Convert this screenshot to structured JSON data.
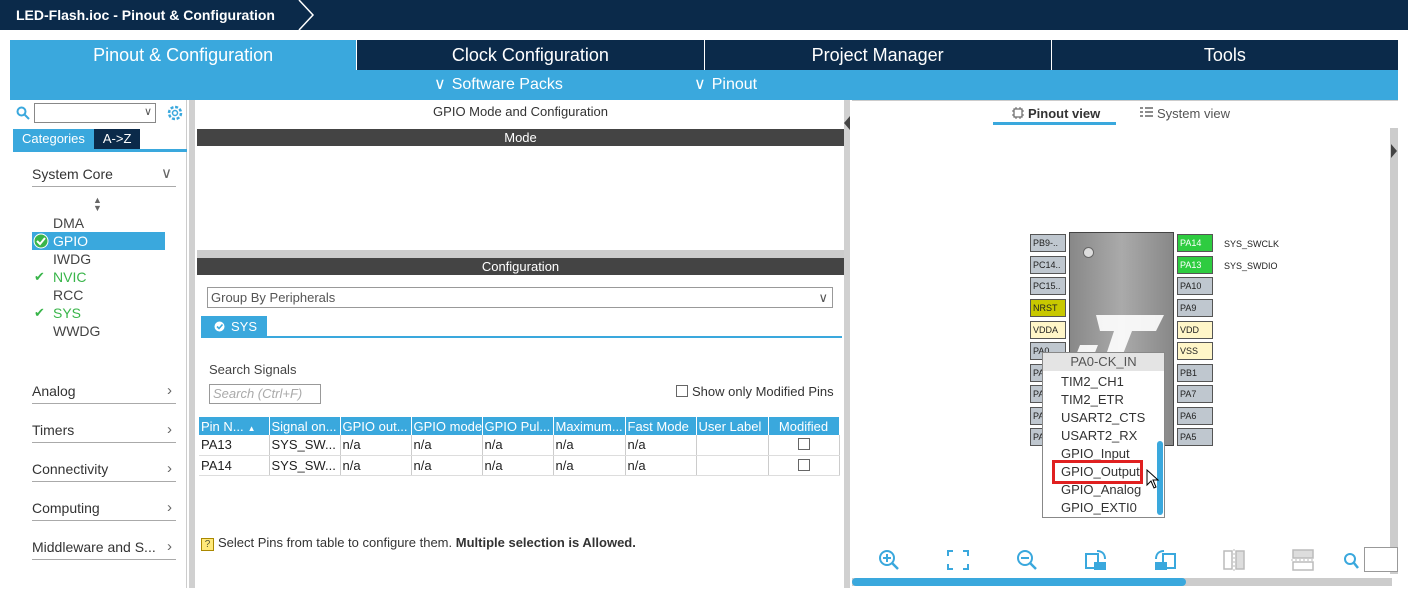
{
  "titlebar": {
    "title": "LED-Flash.ioc - Pinout & Configuration"
  },
  "main_tabs": [
    {
      "label": "Pinout & Configuration"
    },
    {
      "label": "Clock Configuration"
    },
    {
      "label": "Project Manager"
    },
    {
      "label": "Tools"
    }
  ],
  "subbar": {
    "software_packs": "Software Packs",
    "pinout": "Pinout",
    "chev": "∨"
  },
  "left": {
    "tabs": {
      "categories": "Categories",
      "az": "A->Z"
    },
    "groups": {
      "system_core": "System Core",
      "analog": "Analog",
      "timers": "Timers",
      "connectivity": "Connectivity",
      "computing": "Computing",
      "middleware": "Middleware and S..."
    },
    "items": [
      {
        "label": "DMA",
        "state": "none"
      },
      {
        "label": "GPIO",
        "state": "selected"
      },
      {
        "label": "IWDG",
        "state": "none"
      },
      {
        "label": "NVIC",
        "state": "ok"
      },
      {
        "label": "RCC",
        "state": "none"
      },
      {
        "label": "SYS",
        "state": "ok"
      },
      {
        "label": "WWDG",
        "state": "none"
      }
    ]
  },
  "middle": {
    "title": "GPIO Mode and Configuration",
    "mode_header": "Mode",
    "config_header": "Configuration",
    "group_by": "Group By Peripherals",
    "sys_tab": "SYS",
    "search_label": "Search Signals",
    "search_placeholder": "Search (Ctrl+F)",
    "show_modified": "Show only Modified Pins",
    "columns": [
      "Pin N...",
      "Signal on...",
      "GPIO out...",
      "GPIO mode",
      "GPIO Pul...",
      "Maximum...",
      "Fast Mode",
      "User Label",
      "Modified"
    ],
    "rows": [
      [
        "PA13",
        "SYS_SW...",
        "n/a",
        "n/a",
        "n/a",
        "n/a",
        "n/a",
        "",
        ""
      ],
      [
        "PA14",
        "SYS_SW...",
        "n/a",
        "n/a",
        "n/a",
        "n/a",
        "n/a",
        "",
        ""
      ]
    ],
    "hint_normal": "Select Pins from table to configure them.",
    "hint_bold": "Multiple selection is Allowed."
  },
  "right": {
    "pinout_view": "Pinout view",
    "system_view": "System view",
    "left_pins": [
      "PB9-..",
      "PC14..",
      "PC15..",
      "NRST",
      "VDDA",
      "PA0",
      "PA",
      "PA",
      "PA",
      "PA"
    ],
    "right_pins": [
      "PA14",
      "PA13",
      "PA10",
      "PA9",
      "VDD",
      "VSS",
      "PB1",
      "PA7",
      "PA6",
      "PA5"
    ],
    "signal_labels": [
      "SYS_SWCLK",
      "SYS_SWDIO"
    ],
    "popup": {
      "header": "PA0-CK_IN",
      "items": [
        "TIM2_CH1",
        "TIM2_ETR",
        "USART2_CTS",
        "USART2_RX",
        "GPIO_Input",
        "GPIO_Output",
        "GPIO_Analog",
        "GPIO_EXTI0"
      ],
      "selected": "GPIO_Output"
    }
  },
  "colors": {
    "navy": "#0b2a4a",
    "accent": "#3aa8dd",
    "green": "#2ecc40",
    "check": "#39b54a",
    "highlight": "#e02020"
  }
}
